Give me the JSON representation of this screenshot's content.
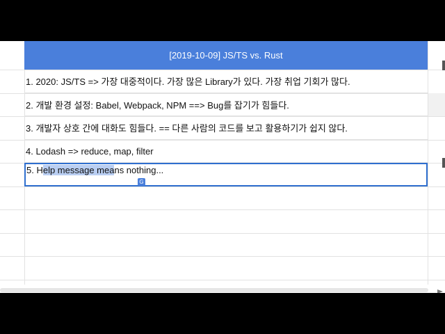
{
  "sheet": {
    "header": "[2019-10-09] JS/TS vs. Rust",
    "rows": [
      "1. 2020: JS/TS => 가장 대중적이다. 가장 많은 Library가 있다. 가장 취업 기회가 많다.",
      "2. 개발 환경 설정: Babel, Webpack, NPM ==> Bug를 잡기가 힘들다.",
      "3. 개발자 상호 간에 대화도 힘들다. == 다른 사람의 코드를 보고 활용하기가 쉽지 않다.",
      "4. Lodash => reduce, map, filter"
    ],
    "active_cell": {
      "prefix": "5. H",
      "selected": "elp message mea",
      "suffix": "ns nothing..."
    }
  },
  "colors": {
    "header_bg": "#4a7fdb",
    "selection": "#b9cef2",
    "active_border": "#2f6fcf"
  },
  "icons": {
    "translate": "translate-icon"
  }
}
